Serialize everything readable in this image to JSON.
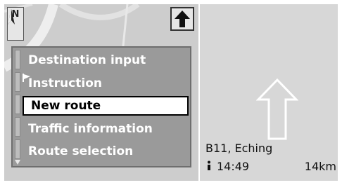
{
  "compass": {
    "label": "N"
  },
  "menu": {
    "items": [
      {
        "label": "Destination input",
        "selected": false
      },
      {
        "label": "Instruction",
        "selected": false,
        "has_flag": true
      },
      {
        "label": "New route",
        "selected": true
      },
      {
        "label": "Traffic information",
        "selected": false
      },
      {
        "label": "Route selection",
        "selected": false
      }
    ]
  },
  "guidance": {
    "street": "B11, Eching",
    "eta": "14:49",
    "distance": "14km",
    "arrow": "straight-ahead-arrow"
  },
  "colors": {
    "map_bg": "#cdcdcd",
    "menu_bg": "#9a9a9a",
    "guide_bg": "#d7d7d7",
    "selected_bg": "#ffffff"
  }
}
